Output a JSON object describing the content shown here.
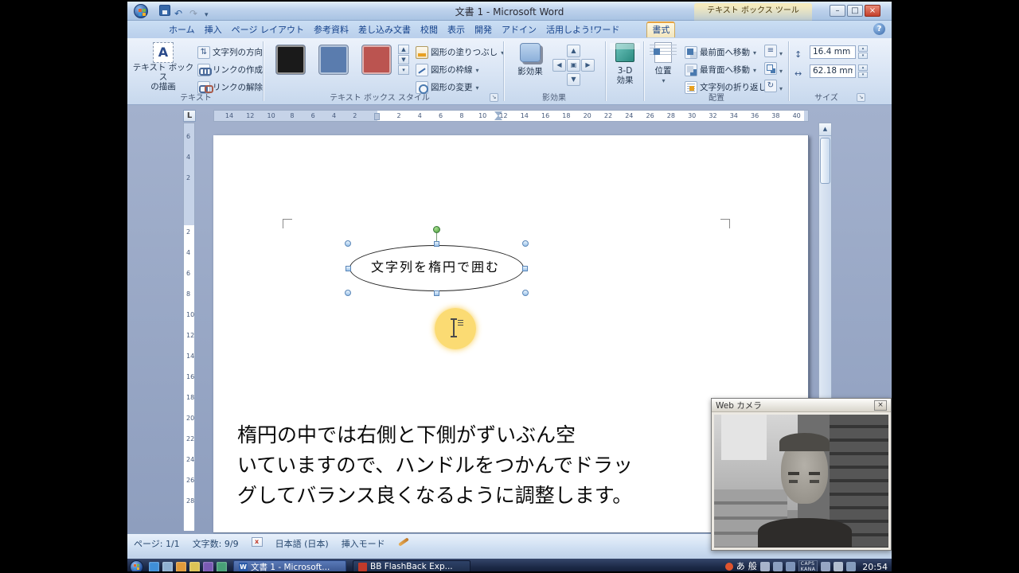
{
  "titlebar": {
    "title": "文書 1 - Microsoft Word",
    "contextual": "テキスト ボックス ツール"
  },
  "tabs": [
    {
      "label": "ホーム"
    },
    {
      "label": "挿入"
    },
    {
      "label": "ページ レイアウト"
    },
    {
      "label": "参考資料"
    },
    {
      "label": "差し込み文書"
    },
    {
      "label": "校閲"
    },
    {
      "label": "表示"
    },
    {
      "label": "開発"
    },
    {
      "label": "アドイン"
    },
    {
      "label": "活用しよう!ワード"
    },
    {
      "label": "書式",
      "active": true
    }
  ],
  "ribbon": {
    "text_group": {
      "label": "テキスト",
      "draw_line1": "テキスト ボックス",
      "draw_line2": "の描画",
      "items": [
        "文字列の方向",
        "リンクの作成",
        "リンクの解除"
      ]
    },
    "style_group": {
      "label": "テキスト ボックス スタイル",
      "swatches": [
        "#1a1a1a",
        "#5a7cae",
        "#bb5450"
      ],
      "items": [
        "図形の塗りつぶし",
        "図形の枠線",
        "図形の変更"
      ]
    },
    "shadow_group": {
      "label": "影効果",
      "button": "影効果"
    },
    "threed_group": {
      "line1": "3-D",
      "line2": "効果"
    },
    "arrange_group": {
      "label": "配置",
      "position": "位置",
      "items": [
        "最前面へ移動",
        "最背面へ移動",
        "文字列の折り返し"
      ]
    },
    "size_group": {
      "label": "サイズ",
      "height": "16.4 mm",
      "width": "62.18 mm"
    }
  },
  "ruler": {
    "h_left": [
      "14",
      "12",
      "10",
      "8",
      "6",
      "4",
      "2"
    ],
    "h_right": [
      "2",
      "4",
      "6",
      "8",
      "10",
      "12",
      "14",
      "16",
      "18",
      "20",
      "22",
      "24",
      "26",
      "28",
      "30",
      "32",
      "34",
      "36",
      "38",
      "40"
    ],
    "v_top": [
      "6",
      "4",
      "2"
    ],
    "v_main": [
      "2",
      "4",
      "6",
      "8",
      "10",
      "12",
      "14",
      "16",
      "18",
      "20",
      "22",
      "24",
      "26",
      "28"
    ]
  },
  "document": {
    "shape_text": "文字列を楕円で囲む",
    "caption": [
      "楕円の中では右側と下側がずいぶん空",
      "いていますので、ハンドルをつかんでドラッ",
      "グしてバランス良くなるように調整します。"
    ]
  },
  "statusbar": {
    "page": "ページ: 1/1",
    "chars": "文字数: 9/9",
    "language": "日本語 (日本)",
    "mode": "挿入モード"
  },
  "webcam": {
    "title": "Web カメラ"
  },
  "taskbar": {
    "buttons": [
      {
        "label": "文書 1 - Microsoft..."
      },
      {
        "label": "BB FlashBack Exp..."
      }
    ],
    "clock": "20:54",
    "caps": "CAPS",
    "kana": "KANA",
    "quick_launch": [
      {
        "name": "browser-icon",
        "color": "#3f8fd8"
      },
      {
        "name": "show-desktop-icon",
        "color": "#8fb0d0"
      },
      {
        "name": "media-player-icon",
        "color": "#e09a3a"
      },
      {
        "name": "explorer-icon",
        "color": "#dcc455"
      },
      {
        "name": "app-icon-1",
        "color": "#7a5ab4"
      },
      {
        "name": "app-icon-2",
        "color": "#48a077"
      }
    ],
    "tray": [
      {
        "name": "recording-indicator",
        "type": "dot",
        "color": "#e0542e"
      },
      {
        "name": "ime-input-mode",
        "type": "text",
        "text": "あ"
      },
      {
        "name": "ime-conversion-mode",
        "type": "text",
        "text": "般"
      },
      {
        "name": "ime-pen-icon",
        "type": "icon",
        "color": "#b6c2d8"
      },
      {
        "name": "ime-dictionary-icon",
        "type": "icon",
        "color": "#98accc"
      },
      {
        "name": "ime-toolbar-icon",
        "type": "icon",
        "color": "#88a0c4"
      },
      {
        "name": "caps-kana-indicator",
        "type": "caps"
      },
      {
        "name": "keyboard-icon",
        "type": "icon",
        "color": "#a4b4d0"
      },
      {
        "name": "volume-icon",
        "type": "icon",
        "color": "#c2cede"
      },
      {
        "name": "network-icon",
        "type": "icon",
        "color": "#90a8c8"
      },
      {
        "name": "clock",
        "type": "clock"
      }
    ]
  }
}
